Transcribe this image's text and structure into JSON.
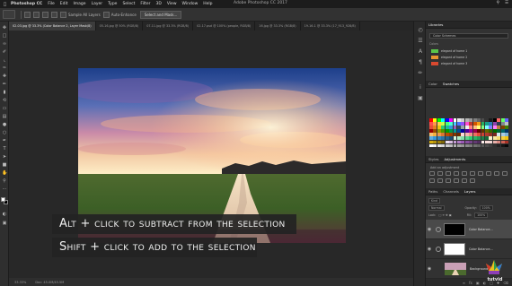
{
  "menubar": {
    "app_name": "Photoshop CC",
    "menus": [
      "File",
      "Edit",
      "Image",
      "Layer",
      "Type",
      "Select",
      "Filter",
      "3D",
      "View",
      "Window",
      "Help"
    ],
    "window_title": "Adobe Photoshop CC 2017"
  },
  "options": {
    "sample_all_layers": "Sample All Layers",
    "auto_enhance": "Auto-Enhance",
    "select_mask_button": "Select and Mask..."
  },
  "tabs": [
    {
      "label": "02-03.jpg @ 33.3% (Color Balance 2, Layer Mask/8)",
      "active": true
    },
    {
      "label": "05-16.jpg @ 50% (RGB/8)",
      "active": false
    },
    {
      "label": "07-11.jpg @ 33.3% (RGB/8)",
      "active": false
    },
    {
      "label": "02-17.psd @ 100% (people, RGB/8)",
      "active": false
    },
    {
      "label": "16.jpg @ 33.3% (RGB/8)",
      "active": false
    },
    {
      "label": "19-16-1 @ 33.3% (17_913_928/8)",
      "active": false
    }
  ],
  "captions": {
    "line1": "Alt + click to subtract from the selection",
    "line2": "Shift + click to add to the selection"
  },
  "statusbar": {
    "zoom": "33.33%",
    "doc": "Doc: 45.0M/45.5M"
  },
  "panels": {
    "libraries": {
      "tab": "Libraries",
      "selected_library": "Color Schemes",
      "section": "Colors",
      "items": [
        "elegant of home 1",
        "elegant of home 2",
        "elegant of home 3"
      ]
    },
    "swatches_tabs": [
      "Color",
      "Swatches"
    ],
    "adjustments_tabs": [
      "Styles",
      "Adjustments"
    ],
    "adjustments_label": "Add an adjustment",
    "layers_tabs": [
      "Paths",
      "Channels",
      "Layers"
    ],
    "layers_controls": {
      "kind": "Kind",
      "blend": "Normal",
      "opacity_label": "Opacity:",
      "opacity": "100%",
      "lock_label": "Lock:",
      "fill_label": "Fill:",
      "fill": "100%"
    },
    "layers": [
      {
        "name": "Color Balance...",
        "selected": true,
        "mask": "black"
      },
      {
        "name": "Color Balance...",
        "selected": false,
        "mask": "white"
      },
      {
        "name": "Background",
        "selected": false,
        "mask": ""
      }
    ]
  },
  "logo_text": "tutvid",
  "colors": {
    "ui_dark": "#2b2b2b",
    "panel": "#323232",
    "library_chip": "#5ac54a"
  }
}
